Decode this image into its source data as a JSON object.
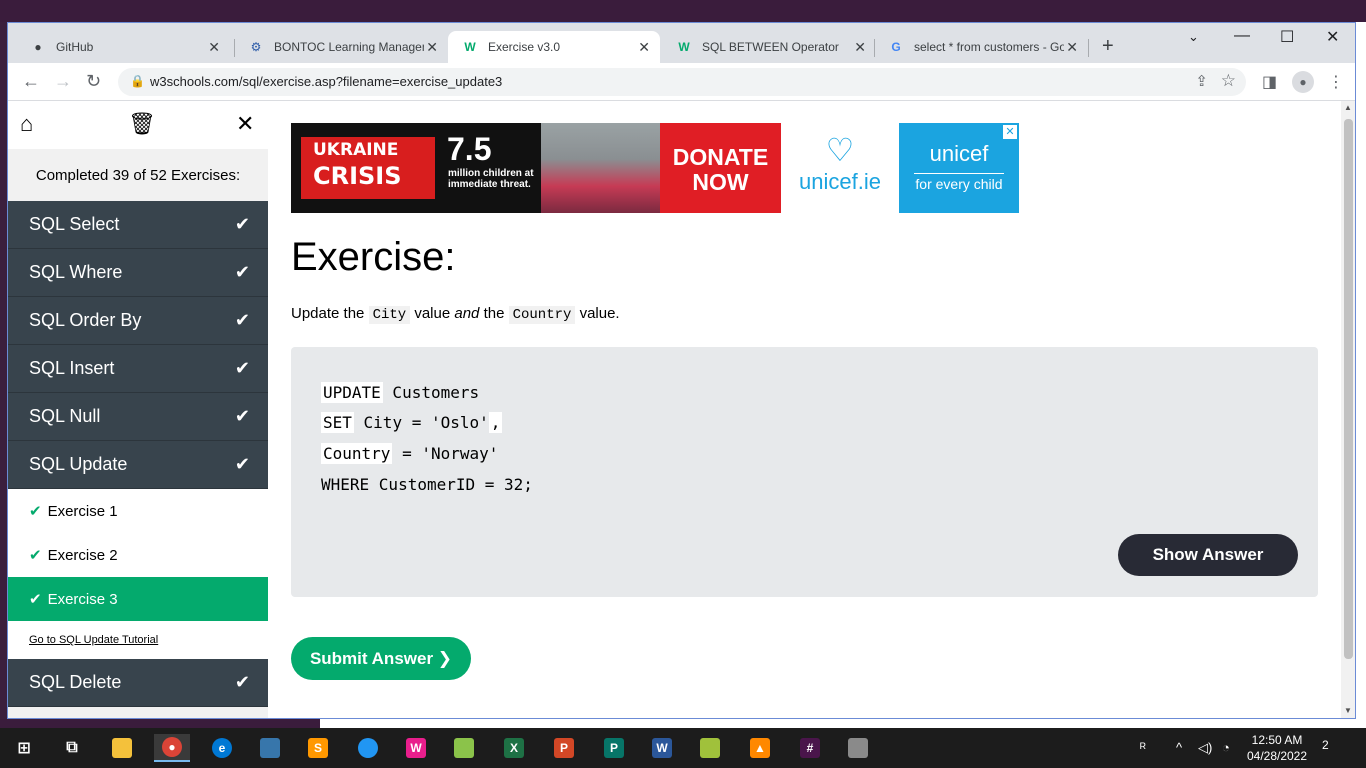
{
  "browser": {
    "tabs": [
      {
        "label": "GitHub",
        "favicon": "github-icon"
      },
      {
        "label": "BONTOC Learning Managem",
        "favicon": "moodle-icon"
      },
      {
        "label": "Exercise v3.0",
        "favicon": "w3schools-icon",
        "active": true
      },
      {
        "label": "SQL BETWEEN Operator",
        "favicon": "w3schools-icon"
      },
      {
        "label": "select * from customers - Go",
        "favicon": "google-icon"
      }
    ],
    "url": "w3schools.com/sql/exercise.asp?filename=exercise_update3"
  },
  "sidebar": {
    "completed": "Completed 39 of 52 Exercises:",
    "items": [
      {
        "label": "SQL Select"
      },
      {
        "label": "SQL Where"
      },
      {
        "label": "SQL Order By"
      },
      {
        "label": "SQL Insert"
      },
      {
        "label": "SQL Null"
      },
      {
        "label": "SQL Update"
      }
    ],
    "sub_items": [
      {
        "label": "Exercise 1"
      },
      {
        "label": "Exercise 2"
      },
      {
        "label": "Exercise 3"
      }
    ],
    "tutorial_link": "Go to SQL Update Tutorial",
    "after_items": [
      {
        "label": "SQL Delete"
      }
    ]
  },
  "ad": {
    "crisis_line1": "UKRAINE",
    "crisis_line2": "CRISIS",
    "number": "7.5",
    "desc": "million children at immediate threat.",
    "donate_line1": "DONATE",
    "donate_line2": "NOW",
    "site": "unicef.ie",
    "brand": "unicef",
    "tagline": "for every child"
  },
  "exercise": {
    "title": "Exercise:",
    "desc_pre": "Update the ",
    "desc_code1": "City",
    "desc_mid1": " value ",
    "desc_and": "and",
    "desc_mid2": " the ",
    "desc_code2": "Country",
    "desc_post": " value.",
    "code": {
      "l1a": "UPDATE",
      "l1b": " Customers",
      "l2a": "SET",
      "l2b": " City = 'Oslo'",
      "l2c": ",",
      "l3a": "Country",
      "l3b": " = 'Norway'",
      "l4": "WHERE CustomerID = 32;"
    },
    "show_answer": "Show Answer",
    "submit": "Submit Answer ❯"
  },
  "taskbar": {
    "time": "12:50 AM",
    "date": "04/28/2022",
    "notifications": "2"
  },
  "colors": {
    "accent_green": "#04aa6d",
    "sidebar_dark": "#38444d",
    "show_btn": "#282a35"
  }
}
